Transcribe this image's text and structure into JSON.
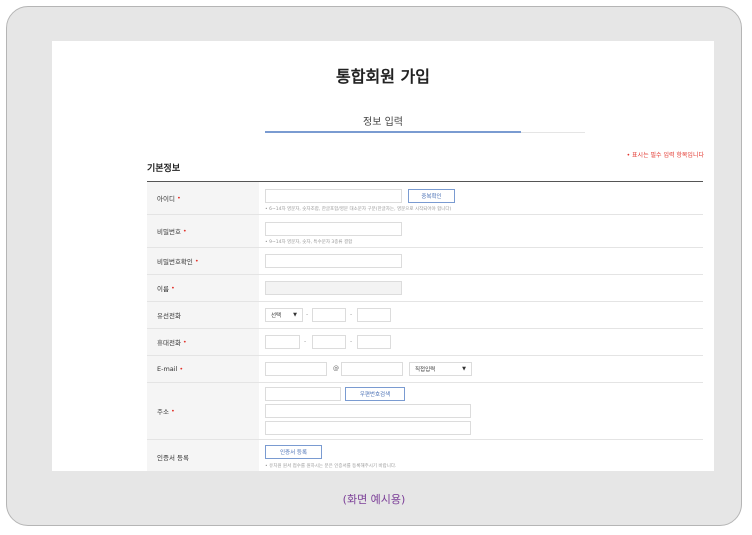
{
  "page": {
    "title": "통합회원 가입",
    "step_label": "정보 입력",
    "step_progress_percent": 80,
    "required_note": "• 표시는 필수 입력 항목입니다",
    "section_title": "기본정보",
    "caption": "(화면 예시용)"
  },
  "form": {
    "userid": {
      "label": "아이디",
      "button": "중복확인",
      "hint": "• 6~14자 영문자, 숫자조합, 한글포함/영문 대소문자 구분(한글자는, 영문으로 시작되어야 합니다)"
    },
    "password": {
      "label": "비밀번호",
      "hint": "• 9~14자 영문자, 숫자, 특수문자 3종류 결합"
    },
    "password_confirm": {
      "label": "비밀번호확인"
    },
    "name": {
      "label": "이름"
    },
    "phone": {
      "label": "유선전화",
      "select_value": "선택",
      "dash": "-"
    },
    "mobile": {
      "label": "휴대전화",
      "dash": "-"
    },
    "email": {
      "label": "E-mail",
      "at": "@",
      "select_value": "직접입력"
    },
    "address": {
      "label": "주소",
      "button": "우편번호검색"
    },
    "certificate": {
      "label": "인증서 등록",
      "button": "인증서 등록",
      "hint": "• 유치원 원서 접수를 원하시는 분은 인증서를 등록해주시기 바랍니다."
    },
    "required_mark": "•"
  },
  "colors": {
    "accent": "#7a9bd1",
    "required": "#e2342c",
    "caption": "#7c3f98"
  }
}
